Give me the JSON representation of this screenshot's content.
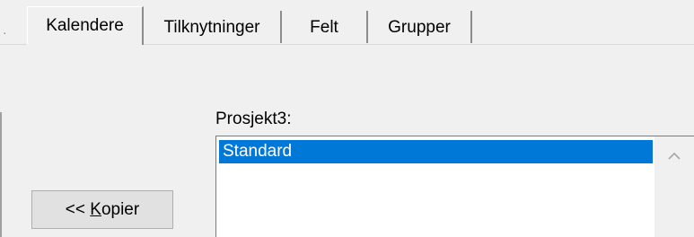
{
  "tabs": [
    {
      "label": "Kalendere",
      "active": true
    },
    {
      "label": "Tilknytninger",
      "active": false
    },
    {
      "label": "Felt",
      "active": false
    },
    {
      "label": "Grupper",
      "active": false
    }
  ],
  "project_label": "Prosjekt3:",
  "calendar_list": {
    "items": [
      {
        "label": "Standard",
        "selected": true
      }
    ]
  },
  "copy_button": {
    "prefix": "<< ",
    "mnemonic": "K",
    "rest": "opier"
  },
  "colors": {
    "selection": "#0078d7",
    "background": "#f0f0f0"
  },
  "icons": {
    "scroll_up": "chevron-up-icon"
  }
}
